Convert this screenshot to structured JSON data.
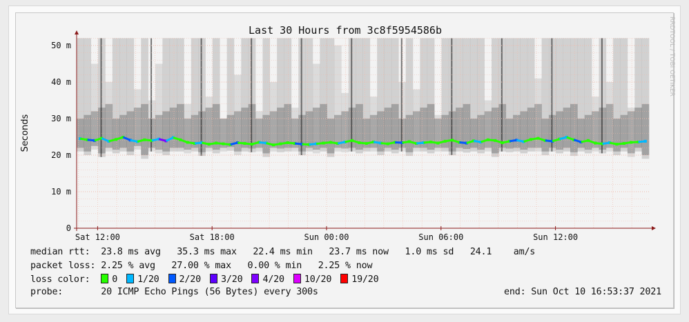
{
  "chart_data": {
    "type": "area",
    "title": "Last 30 Hours from 3c8f5954586b",
    "ylabel": "Seconds",
    "ylim": [
      0,
      52
    ],
    "yticks": [
      {
        "v": 0,
        "label": "0"
      },
      {
        "v": 10,
        "label": "10 m"
      },
      {
        "v": 20,
        "label": "20 m"
      },
      {
        "v": 30,
        "label": "30 m"
      },
      {
        "v": 40,
        "label": "40 m"
      },
      {
        "v": 50,
        "label": "50 m"
      }
    ],
    "xticks": [
      {
        "h": 1.1,
        "label": "Sat 12:00"
      },
      {
        "h": 7.1,
        "label": "Sat 18:00"
      },
      {
        "h": 13.1,
        "label": "Sun 00:00"
      },
      {
        "h": 19.1,
        "label": "Sun 06:00"
      },
      {
        "h": 25.1,
        "label": "Sun 12:00"
      }
    ],
    "xrange_hours": [
      0,
      30
    ],
    "median_ms": [
      24.5,
      24.2,
      24.0,
      24.6,
      23.8,
      24.3,
      24.9,
      24.1,
      23.7,
      24.2,
      24.0,
      24.4,
      23.9,
      24.8,
      24.2,
      23.5,
      23.2,
      23.4,
      23.0,
      23.3,
      23.1,
      22.9,
      23.4,
      23.2,
      23.0,
      23.5,
      23.3,
      22.8,
      23.1,
      23.4,
      23.2,
      23.0,
      22.9,
      23.1,
      23.3,
      23.5,
      23.2,
      23.6,
      24.0,
      23.4,
      23.2,
      23.6,
      23.3,
      23.1,
      23.5,
      23.4,
      23.7,
      23.2,
      23.4,
      23.6,
      23.3,
      23.8,
      24.1,
      23.5,
      23.3,
      23.9,
      23.6,
      24.2,
      24.0,
      23.4,
      23.8,
      24.1,
      23.7,
      24.3,
      24.6,
      24.0,
      23.8,
      24.4,
      24.9,
      24.2,
      23.6,
      24.0,
      23.3,
      23.1,
      23.4,
      23.0,
      23.2,
      23.5,
      23.6,
      23.8
    ],
    "loss_index": [
      1,
      0,
      2,
      0,
      1,
      0,
      0,
      2,
      1,
      0,
      0,
      1,
      4,
      1,
      0,
      0,
      0,
      1,
      0,
      0,
      0,
      0,
      2,
      0,
      0,
      0,
      1,
      0,
      0,
      0,
      0,
      2,
      0,
      1,
      0,
      0,
      0,
      1,
      0,
      0,
      0,
      0,
      1,
      0,
      0,
      2,
      0,
      0,
      1,
      0,
      0,
      0,
      0,
      0,
      2,
      0,
      1,
      0,
      0,
      0,
      0,
      2,
      1,
      0,
      0,
      0,
      2,
      0,
      1,
      0,
      2,
      0,
      0,
      0,
      1,
      0,
      0,
      0,
      0,
      1
    ],
    "smoke_max_ms": [
      52,
      52,
      45,
      52,
      40,
      52,
      52,
      52,
      38,
      52,
      35,
      45,
      52,
      52,
      52,
      34,
      52,
      52,
      36,
      52,
      30,
      52,
      42,
      52,
      52,
      32,
      52,
      40,
      52,
      52,
      33,
      52,
      52,
      45,
      52,
      52,
      50,
      37,
      52,
      52,
      52,
      36,
      52,
      52,
      52,
      40,
      52,
      38,
      52,
      52,
      31,
      52,
      52,
      52,
      52,
      52,
      52,
      35,
      52,
      52,
      52,
      52,
      52,
      52,
      41,
      52,
      52,
      52,
      52,
      52,
      52,
      52,
      36,
      52,
      40,
      52,
      52,
      33,
      52,
      52
    ],
    "smoke_min_ms": [
      21,
      20,
      21.5,
      19.5,
      21,
      20.5,
      21,
      20,
      21.5,
      19,
      21,
      20.5,
      20,
      21,
      21,
      20.5,
      21,
      19.8,
      21,
      20.5,
      21,
      21.2,
      20,
      21,
      20.8,
      21,
      19.5,
      21,
      20.8,
      21,
      21,
      20,
      21,
      20.5,
      21,
      19.5,
      21,
      20.8,
      21,
      20.5,
      21,
      21,
      20,
      21,
      20.5,
      21,
      19.8,
      21,
      21,
      20.5,
      21,
      21,
      20,
      21,
      20.7,
      21,
      20.5,
      21,
      19.5,
      21,
      20.8,
      21,
      20.5,
      21,
      21,
      20,
      21,
      20.5,
      21,
      19.8,
      21,
      20.5,
      21,
      20.5,
      21,
      20,
      21,
      19.5,
      21,
      19
    ],
    "series_colors": {
      "smoke": "#7a7a7a",
      "grid": "#f2b8a8",
      "axis": "#8b1a1a"
    }
  },
  "stats": {
    "median_label": "median rtt:",
    "median_values": "23.8 ms avg   35.3 ms max   22.4 ms min   23.7 ms now   1.0 ms sd   24.1    am/s",
    "loss_label": "packet loss:",
    "loss_values": "2.25 % avg   27.00 % max   0.00 % min   2.25 % now",
    "color_label": "loss color:",
    "loss_colors": [
      {
        "label": "0",
        "color": "#26ff00"
      },
      {
        "label": "1/20",
        "color": "#00b8ff"
      },
      {
        "label": "2/20",
        "color": "#0059ff"
      },
      {
        "label": "3/20",
        "color": "#5e00ff"
      },
      {
        "label": "4/20",
        "color": "#7e00ff"
      },
      {
        "label": "10/20",
        "color": "#dd00ff"
      },
      {
        "label": "19/20",
        "color": "#ff0000"
      }
    ],
    "probe_label": "probe:",
    "probe_value": "20 ICMP Echo Pings (56 Bytes) every 300s",
    "end_value": "end: Sun Oct 10 16:53:37 2021"
  },
  "watermark": "RRDTOOL / TOBI OETIKER"
}
